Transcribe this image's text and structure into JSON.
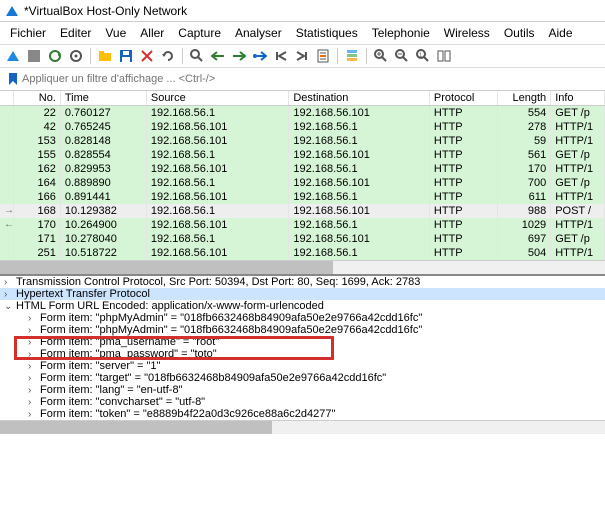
{
  "window": {
    "title": "*VirtualBox Host-Only Network"
  },
  "menu": {
    "file": "Fichier",
    "edit": "Editer",
    "view": "Vue",
    "go": "Aller",
    "capture": "Capture",
    "analyze": "Analyser",
    "stats": "Statistiques",
    "tele": "Telephonie",
    "wireless": "Wireless",
    "tools": "Outils",
    "help": "Aide"
  },
  "filter": {
    "placeholder": "Appliquer un filtre d'affichage ... <Ctrl-/>"
  },
  "columns": {
    "no": "No.",
    "time": "Time",
    "source": "Source",
    "dest": "Destination",
    "proto": "Protocol",
    "len": "Length",
    "info": "Info"
  },
  "packets": [
    {
      "no": "22",
      "time": "0.760127",
      "src": "192.168.56.1",
      "dst": "192.168.56.101",
      "proto": "HTTP",
      "len": "554",
      "info": "GET /p",
      "mark": ""
    },
    {
      "no": "42",
      "time": "0.765245",
      "src": "192.168.56.101",
      "dst": "192.168.56.1",
      "proto": "HTTP",
      "len": "278",
      "info": "HTTP/1",
      "mark": ""
    },
    {
      "no": "153",
      "time": "0.828148",
      "src": "192.168.56.101",
      "dst": "192.168.56.1",
      "proto": "HTTP",
      "len": "59",
      "info": "HTTP/1",
      "mark": ""
    },
    {
      "no": "155",
      "time": "0.828554",
      "src": "192.168.56.1",
      "dst": "192.168.56.101",
      "proto": "HTTP",
      "len": "561",
      "info": "GET /p",
      "mark": ""
    },
    {
      "no": "162",
      "time": "0.829953",
      "src": "192.168.56.101",
      "dst": "192.168.56.1",
      "proto": "HTTP",
      "len": "170",
      "info": "HTTP/1",
      "mark": ""
    },
    {
      "no": "164",
      "time": "0.889890",
      "src": "192.168.56.1",
      "dst": "192.168.56.101",
      "proto": "HTTP",
      "len": "700",
      "info": "GET /p",
      "mark": ""
    },
    {
      "no": "166",
      "time": "0.891441",
      "src": "192.168.56.101",
      "dst": "192.168.56.1",
      "proto": "HTTP",
      "len": "611",
      "info": "HTTP/1",
      "mark": ""
    },
    {
      "no": "168",
      "time": "10.129382",
      "src": "192.168.56.1",
      "dst": "192.168.56.101",
      "proto": "HTTP",
      "len": "988",
      "info": "POST /",
      "mark": "→",
      "sel": true
    },
    {
      "no": "170",
      "time": "10.264900",
      "src": "192.168.56.101",
      "dst": "192.168.56.1",
      "proto": "HTTP",
      "len": "1029",
      "info": "HTTP/1",
      "mark": "←"
    },
    {
      "no": "171",
      "time": "10.278040",
      "src": "192.168.56.1",
      "dst": "192.168.56.101",
      "proto": "HTTP",
      "len": "697",
      "info": "GET /p",
      "mark": ""
    },
    {
      "no": "251",
      "time": "10.518722",
      "src": "192.168.56.101",
      "dst": "192.168.56.1",
      "proto": "HTTP",
      "len": "504",
      "info": "HTTP/1",
      "mark": ""
    }
  ],
  "details": {
    "tcp": "Transmission Control Protocol, Src Port: 50394, Dst Port: 80, Seq: 1699, Ack: 2783",
    "http": "Hypertext Transfer Protocol",
    "form_header": "HTML Form URL Encoded: application/x-www-form-urlencoded",
    "items": [
      "Form item: \"phpMyAdmin\" = \"018fb6632468b84909afa50e2e9766a42cdd16fc\"",
      "Form item: \"phpMyAdmin\" = \"018fb6632468b84909afa50e2e9766a42cdd16fc\"",
      "Form item: \"pma_username\" = \"root\"",
      "Form item: \"pma_password\" = \"toto\"",
      "Form item: \"server\" = \"1\"",
      "Form item: \"target\" = \"018fb6632468b84909afa50e2e9766a42cdd16fc\"",
      "Form item: \"lang\" = \"en-utf-8\"",
      "Form item: \"convcharset\" = \"utf-8\"",
      "Form item: \"token\" = \"e8889b4f22a0d3c926ce88a6c2d4277\""
    ]
  }
}
